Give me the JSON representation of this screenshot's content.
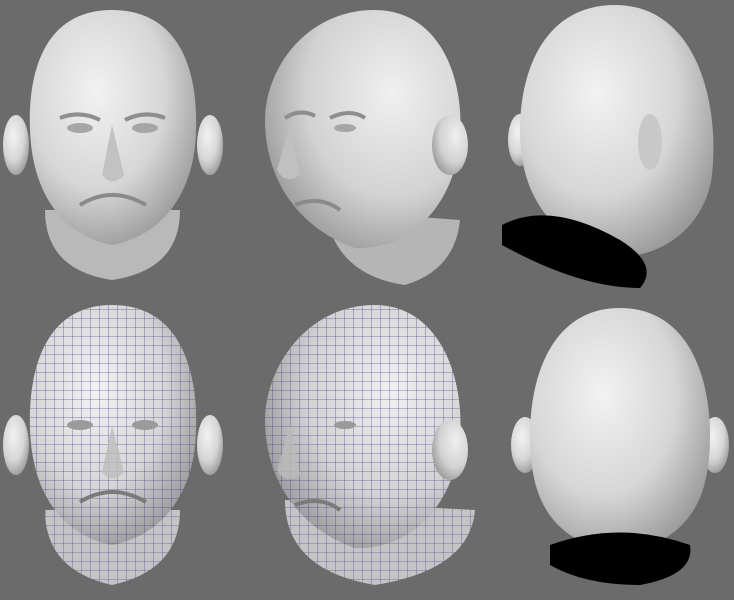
{
  "scene": {
    "background": "#6b6b6b",
    "skin_light": "#e8e8e8",
    "skin_mid": "#c9c9c9",
    "skin_shadow": "#9a9a9a",
    "wire_color": "#2a2a8a",
    "cut_color": "#000000"
  },
  "renders": [
    {
      "view": "front",
      "wireframe": false
    },
    {
      "view": "three-quarter-left",
      "wireframe": false
    },
    {
      "view": "back-three-quarter",
      "wireframe": false
    },
    {
      "view": "front",
      "wireframe": true
    },
    {
      "view": "three-quarter-left",
      "wireframe": true
    },
    {
      "view": "back",
      "wireframe": false
    }
  ]
}
